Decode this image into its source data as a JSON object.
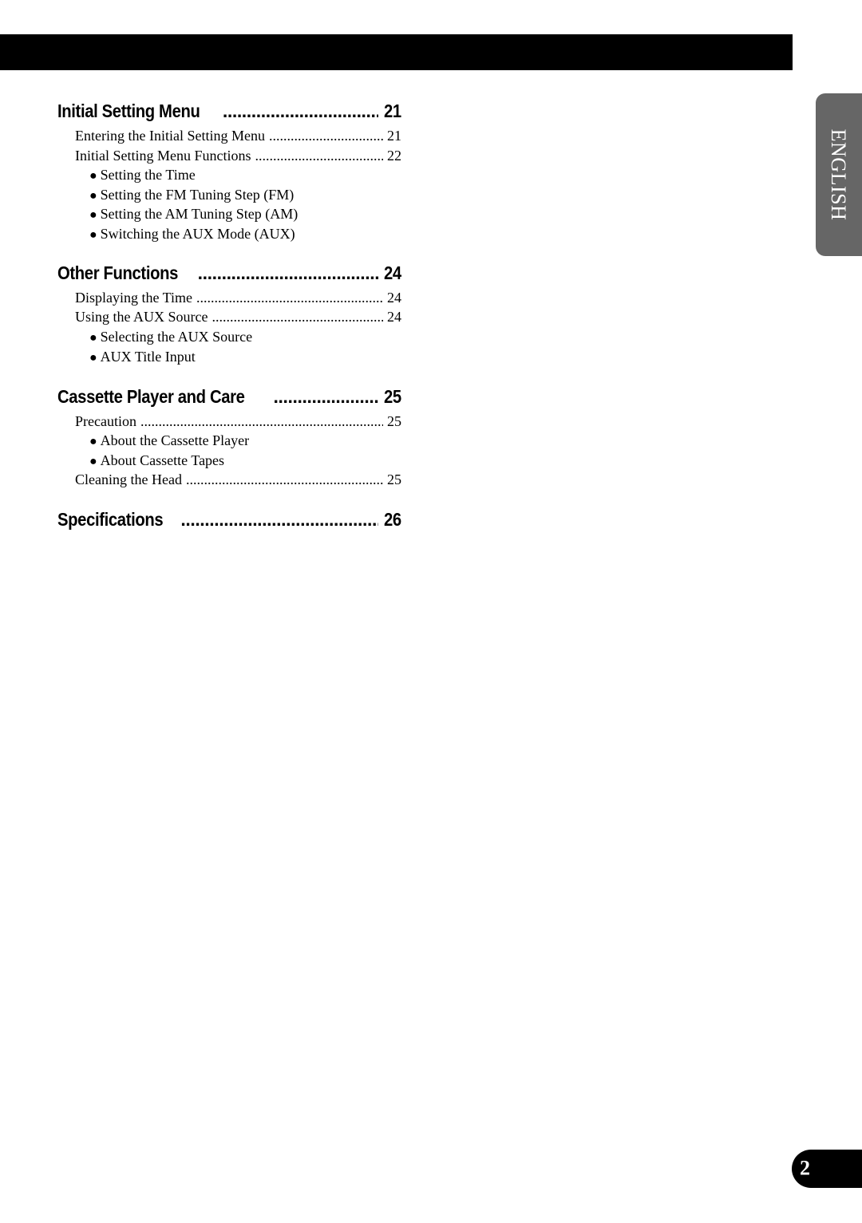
{
  "language_tab": "ENGLISH",
  "page_number": "2",
  "toc": {
    "sections": [
      {
        "title": "Initial Setting Menu",
        "page": "21",
        "entries": [
          {
            "title": "Entering the Initial Setting Menu",
            "page": "21"
          },
          {
            "title": "Initial Setting Menu Functions",
            "page": "22"
          }
        ],
        "bullets": [
          "Setting the Time",
          "Setting the FM Tuning Step (FM)",
          "Setting the AM Tuning Step (AM)",
          "Switching the AUX Mode (AUX)"
        ]
      },
      {
        "title": "Other Functions",
        "page": "24",
        "entries": [
          {
            "title": "Displaying the Time",
            "page": "24"
          },
          {
            "title": "Using the AUX Source",
            "page": "24"
          }
        ],
        "bullets": [
          "Selecting the AUX Source",
          "AUX Title Input"
        ]
      },
      {
        "title": "Cassette Player and Care",
        "page": "25",
        "entries": [
          {
            "title": "Precaution",
            "page": "25"
          },
          {
            "title": "Cleaning the Head",
            "page": "25"
          }
        ],
        "bullets": [
          "About the Cassette Player",
          "About Cassette Tapes"
        ]
      },
      {
        "title": "Specifications",
        "page": "26"
      }
    ]
  }
}
